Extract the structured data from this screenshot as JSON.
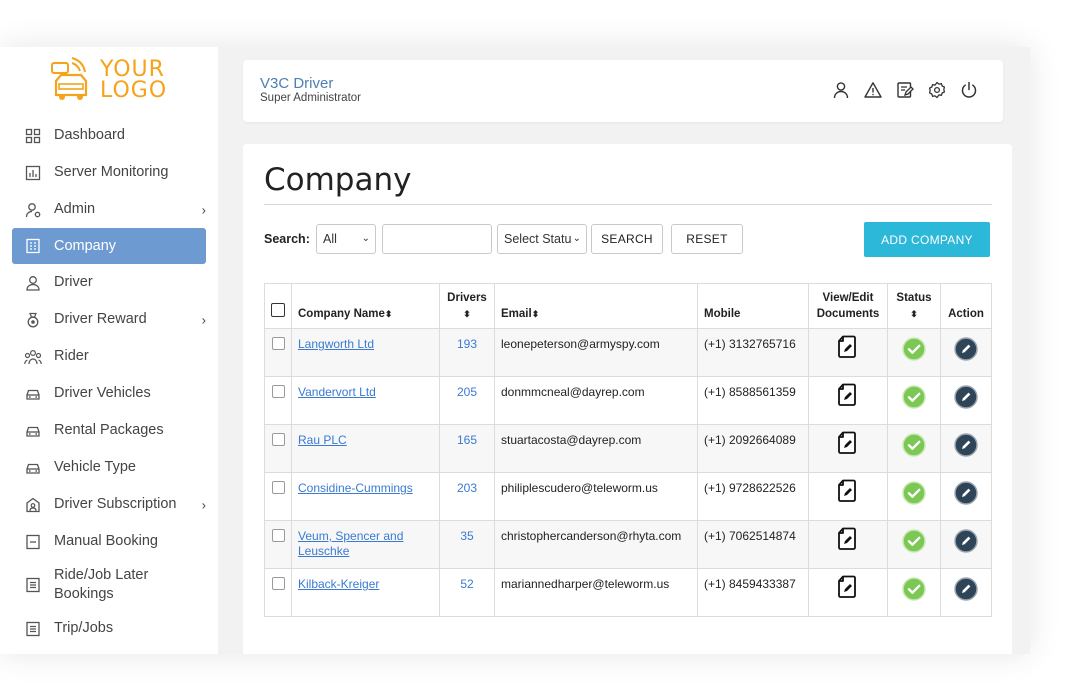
{
  "logo": {
    "line1": "YOUR",
    "line2": "LOGO"
  },
  "sidebar": {
    "items": [
      {
        "label": "Dashboard",
        "icon": "dashboard-icon"
      },
      {
        "label": "Server Monitoring",
        "icon": "chart-icon"
      },
      {
        "label": "Admin",
        "icon": "user-gear-icon",
        "has_submenu": true
      },
      {
        "label": "Company",
        "icon": "building-icon",
        "active": true
      },
      {
        "label": "Driver",
        "icon": "user-icon"
      },
      {
        "label": "Driver Reward",
        "icon": "medal-icon",
        "has_submenu": true
      },
      {
        "label": "Rider",
        "icon": "users-icon"
      },
      {
        "label": "Driver Vehicles",
        "icon": "car-icon"
      },
      {
        "label": "Rental Packages",
        "icon": "car-icon"
      },
      {
        "label": "Vehicle Type",
        "icon": "car-icon"
      },
      {
        "label": "Driver Subscription",
        "icon": "subscription-icon",
        "has_submenu": true
      },
      {
        "label": "Manual Booking",
        "icon": "booking-icon"
      },
      {
        "label": "Ride/Job Later\nBookings",
        "icon": "list-icon"
      },
      {
        "label": "Trip/Jobs",
        "icon": "list-icon"
      }
    ]
  },
  "header": {
    "title": "V3C Driver",
    "subtitle": "Super Administrator"
  },
  "page": {
    "title": "Company"
  },
  "toolbar": {
    "search_label": "Search:",
    "field_select": "All",
    "search_value": "",
    "status_select": "Select Status",
    "search_button": "SEARCH",
    "reset_button": "RESET",
    "add_button": "ADD COMPANY"
  },
  "table": {
    "headers": {
      "company": "Company Name",
      "drivers": "Drivers",
      "email": "Email",
      "mobile": "Mobile",
      "docs_line1": "View/Edit",
      "docs_line2": "Documents",
      "status": "Status",
      "action": "Action"
    },
    "sort_glyph": "⬍",
    "rows": [
      {
        "company": "Langworth Ltd",
        "drivers": "193",
        "email": "leonepeterson@armyspy.com",
        "mobile": "(+1) 3132765716"
      },
      {
        "company": "Vandervort Ltd",
        "drivers": "205",
        "email": "donmmcneal@dayrep.com",
        "mobile": "(+1) 8588561359"
      },
      {
        "company": "Rau PLC",
        "drivers": "165",
        "email": "stuartacosta@dayrep.com",
        "mobile": "(+1) 2092664089"
      },
      {
        "company": "Considine-Cummings",
        "drivers": "203",
        "email": "philiplescudero@teleworm.us",
        "mobile": "(+1) 9728622526"
      },
      {
        "company": "Veum, Spencer and Leuschke",
        "drivers": "35",
        "email": "christophercanderson@rhyta.com",
        "mobile": "(+1) 7062514874"
      },
      {
        "company": "Kilback-Kreiger",
        "drivers": "52",
        "email": "mariannedharper@teleworm.us",
        "mobile": "(+1) 8459433387"
      }
    ]
  },
  "colors": {
    "accent": "#6d9bd1",
    "add_button": "#2bb8d9",
    "status_ok": "#7cc855",
    "action": "#2f4456",
    "logo": "#f5a31a"
  }
}
